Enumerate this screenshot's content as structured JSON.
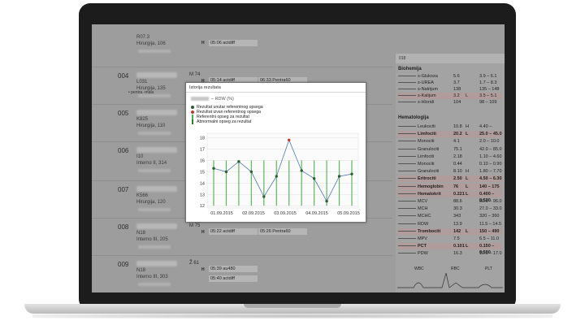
{
  "patients": [
    {
      "num": "",
      "code": "R07.3",
      "dept": "Hirurgija, 106",
      "tag": "",
      "h_time": "05:06 actdiff",
      "h_box2": "",
      "sub": ""
    },
    {
      "num": "004",
      "code": "L031",
      "dept": "Hirurgija, 135",
      "tag": "M 74",
      "h_time": "05:14 actdiff",
      "h_box2": "06:33 Pentra60",
      "sub": "• pentra -mala"
    },
    {
      "num": "005",
      "code": "K825",
      "dept": "Hirurgija, 110",
      "tag": "",
      "h_time": "",
      "h_box2": "",
      "sub": ""
    },
    {
      "num": "006",
      "code": "I10",
      "dept": "Interno II, 314",
      "tag": "",
      "h_time": "",
      "h_box2": "",
      "sub": ""
    },
    {
      "num": "007",
      "code": "K566",
      "dept": "Hirurgija, 120",
      "tag": "",
      "h_time": "",
      "h_box2": "",
      "sub": ""
    },
    {
      "num": "008",
      "code": "N18",
      "dept": "Interno III, 205",
      "tag": "M 75",
      "h_time": "05:22 actdiff",
      "h_box2": "05:26 Pentra60",
      "sub": ""
    },
    {
      "num": "009",
      "code": "N18",
      "dept": "Interno III, 303",
      "tag": "Ž 61",
      "h_time": "05:39 au480",
      "h_box2": "",
      "sub": ""
    }
  ],
  "extra_box": "05:40 actdiff",
  "lab_panel": {
    "header": "018",
    "biohemija_title": "Biohemija",
    "biohemija": [
      {
        "name": "s-Glukoza",
        "value": "5.6",
        "flag": "",
        "range": "3.9 – 6.1",
        "hl": false
      },
      {
        "name": "s-UREA",
        "value": "3.7",
        "flag": "",
        "range": "1.7 – 8.3",
        "hl": false
      },
      {
        "name": "s-Natrijum",
        "value": "138",
        "flag": "",
        "range": "135 – 148",
        "hl": false
      },
      {
        "name": "s-Kalijum",
        "value": "3.2",
        "flag": "L",
        "range": "3.5 – 5.1",
        "hl": true
      },
      {
        "name": "s-Hloridi",
        "value": "104",
        "flag": "",
        "range": "98 – 109",
        "hl": false
      }
    ],
    "hematologija_title": "Hematologija",
    "hematologija": [
      {
        "name": "Leukociti",
        "value": "10.8",
        "flag": "H",
        "range": "4.40 – 10.50",
        "hl": false,
        "bold": false
      },
      {
        "name": "Limfociti",
        "value": "20.2",
        "flag": "L",
        "range": "25.0 – 45.0",
        "hl": true,
        "bold": true
      },
      {
        "name": "Monociti",
        "value": "4.1",
        "flag": "",
        "range": "2.0 – 10.0",
        "hl": false,
        "bold": false
      },
      {
        "name": "Granulociti",
        "value": "75.1",
        "flag": "",
        "range": "42.0 – 85.0",
        "hl": false,
        "bold": false
      },
      {
        "name": "Limfociti",
        "value": "2.18",
        "flag": "",
        "range": "1.10 – 4.60",
        "hl": false,
        "bold": false
      },
      {
        "name": "Monociti",
        "value": "0.44",
        "flag": "",
        "range": "0.10 – 0.90",
        "hl": false,
        "bold": false
      },
      {
        "name": "Granulociti",
        "value": "8.10",
        "flag": "H",
        "range": "1.80 – 7.70",
        "hl": false,
        "bold": false
      },
      {
        "name": "Eritrociti",
        "value": "2.50",
        "flag": "L",
        "range": "4.50 – 6.30",
        "hl": true,
        "bold": true
      },
      {
        "name": "Hemoglobin",
        "value": "76",
        "flag": "L",
        "range": "140 – 175",
        "hl": true,
        "bold": true
      },
      {
        "name": "Hematokrit",
        "value": "0.221",
        "flag": "L",
        "range": "0.400 – 0.520",
        "hl": true,
        "bold": true
      },
      {
        "name": "MCV",
        "value": "88.6",
        "flag": "",
        "range": "80.0 – 96.0",
        "hl": false,
        "bold": false
      },
      {
        "name": "MCH",
        "value": "30.3",
        "flag": "",
        "range": "27.0 – 33.0",
        "hl": false,
        "bold": false
      },
      {
        "name": "MCHC",
        "value": "343",
        "flag": "",
        "range": "320 – 360",
        "hl": false,
        "bold": false
      },
      {
        "name": "RDW",
        "value": "13.9",
        "flag": "",
        "range": "11.5 – 14.5",
        "hl": false,
        "bold": false
      },
      {
        "name": "Trombociti",
        "value": "142",
        "flag": "L",
        "range": "150 – 490",
        "hl": true,
        "bold": true
      },
      {
        "name": "MPV",
        "value": "7.5",
        "flag": "",
        "range": "6.5 – 11.0",
        "hl": false,
        "bold": false
      },
      {
        "name": "PCT",
        "value": "0.101",
        "flag": "L",
        "range": "0.150 – 0.500",
        "hl": true,
        "bold": true
      },
      {
        "name": "PDW",
        "value": "16.3",
        "flag": "",
        "range": "10.0 – 17.0",
        "hl": false,
        "bold": false
      }
    ],
    "ecg_labels": [
      "WBC",
      "RBC",
      "PLT"
    ]
  },
  "popup": {
    "title": "Istorija rezultata",
    "subtitle": "– RDW (%)",
    "legend": [
      {
        "label": "Rezultat unutar referentnog opsega",
        "color": "#2e5d2e",
        "kind": "dot"
      },
      {
        "label": "Rezultat izvan referentnog opsega",
        "color": "#c0392b",
        "kind": "dot"
      },
      {
        "label": "Referentni opseg za rezultat",
        "color": "#4caf50",
        "kind": "bar"
      },
      {
        "label": "Abnormalni opseg za rezultat",
        "color": "#2e7d32",
        "kind": "bar"
      }
    ]
  },
  "chart_data": {
    "type": "line",
    "x": [
      "01.09.2015",
      "01.09.2015",
      "02.09.2015",
      "02.09.2015",
      "03.09.2015",
      "03.09.2015",
      "03.09.2015",
      "04.09.2015",
      "04.09.2015",
      "04.09.2015",
      "05.09.2015",
      "05.09.2015"
    ],
    "values": [
      15.3,
      15.0,
      15.9,
      15.0,
      12.8,
      14.6,
      17.8,
      15.1,
      14.4,
      12.4,
      14.6,
      14.8
    ],
    "out_of_range": [
      false,
      false,
      false,
      false,
      false,
      false,
      true,
      false,
      false,
      false,
      false,
      false
    ],
    "xticks": [
      "01.09.2015",
      "02.09.2015",
      "03.09.2015",
      "04.09.2015",
      "05.09.2015"
    ],
    "yticks": [
      12,
      13,
      14,
      15,
      16,
      17,
      18
    ],
    "ylim": [
      11.8,
      18.4
    ],
    "reference_range": [
      12,
      16
    ],
    "line_color": "#4a78b5",
    "ref_color": "#5cb85c",
    "grid": true
  }
}
